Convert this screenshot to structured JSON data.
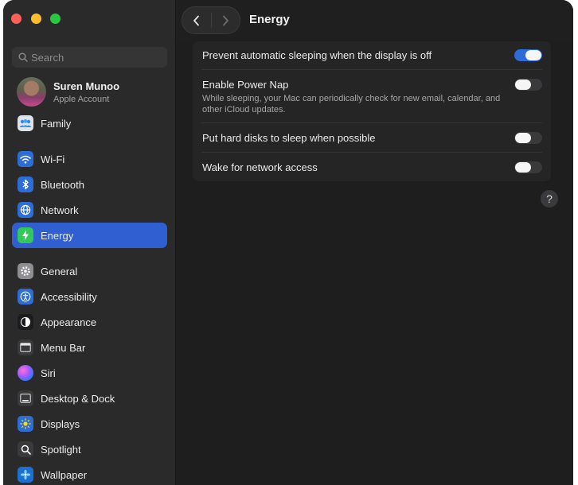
{
  "window": {
    "title": "Energy"
  },
  "search": {
    "placeholder": "Search"
  },
  "account": {
    "name": "Suren Munoo",
    "subtitle": "Apple Account"
  },
  "family": {
    "label": "Family"
  },
  "sidebar": {
    "items": [
      {
        "label": "Wi-Fi",
        "icon": "wifi-icon"
      },
      {
        "label": "Bluetooth",
        "icon": "bluetooth-icon"
      },
      {
        "label": "Network",
        "icon": "globe-icon"
      },
      {
        "label": "Energy",
        "icon": "lightning-icon",
        "selected": true
      },
      {
        "label": "General",
        "icon": "gear-icon"
      },
      {
        "label": "Accessibility",
        "icon": "accessibility-icon"
      },
      {
        "label": "Appearance",
        "icon": "appearance-icon"
      },
      {
        "label": "Menu Bar",
        "icon": "menu-bar-icon"
      },
      {
        "label": "Siri",
        "icon": "siri-icon"
      },
      {
        "label": "Desktop & Dock",
        "icon": "desktop-dock-icon"
      },
      {
        "label": "Displays",
        "icon": "displays-icon"
      },
      {
        "label": "Spotlight",
        "icon": "spotlight-icon"
      },
      {
        "label": "Wallpaper",
        "icon": "wallpaper-icon"
      }
    ]
  },
  "settings": [
    {
      "title": "Prevent automatic sleeping when the display is off",
      "on": true
    },
    {
      "title": "Enable Power Nap",
      "description": "While sleeping, your Mac can periodically check for new email, calendar, and other iCloud updates.",
      "on": false
    },
    {
      "title": "Put hard disks to sleep when possible",
      "on": false
    },
    {
      "title": "Wake for network access",
      "on": false
    }
  ],
  "help": {
    "label": "?"
  },
  "colors": {
    "accent": "#2f5fd0",
    "toggle_on": "#2f6bd8",
    "background": "#1e1e1f",
    "sidebar": "#2a2a2b"
  }
}
